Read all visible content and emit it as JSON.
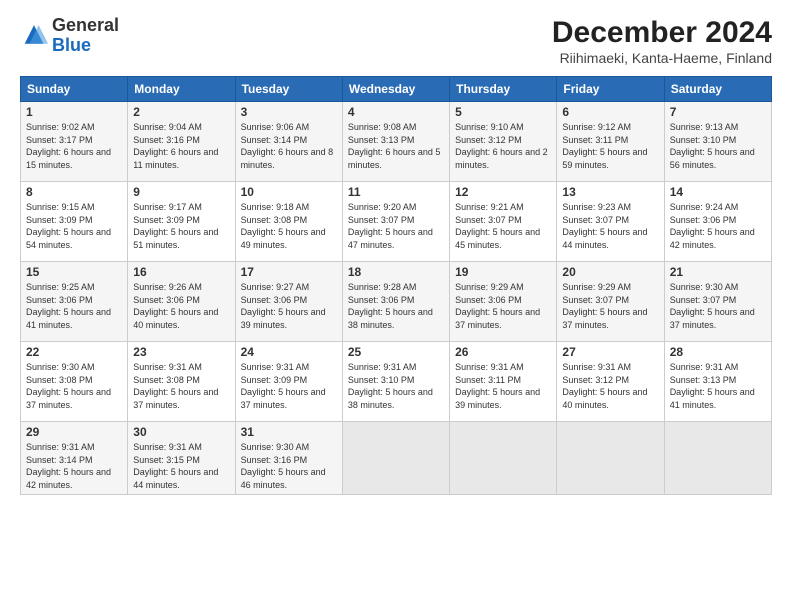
{
  "logo": {
    "general": "General",
    "blue": "Blue"
  },
  "title": "December 2024",
  "subtitle": "Riihimaeki, Kanta-Haeme, Finland",
  "days": [
    "Sunday",
    "Monday",
    "Tuesday",
    "Wednesday",
    "Thursday",
    "Friday",
    "Saturday"
  ],
  "weeks": [
    [
      {
        "num": "1",
        "sunrise": "9:02 AM",
        "sunset": "3:17 PM",
        "daylight": "6 hours and 15 minutes."
      },
      {
        "num": "2",
        "sunrise": "9:04 AM",
        "sunset": "3:16 PM",
        "daylight": "6 hours and 11 minutes."
      },
      {
        "num": "3",
        "sunrise": "9:06 AM",
        "sunset": "3:14 PM",
        "daylight": "6 hours and 8 minutes."
      },
      {
        "num": "4",
        "sunrise": "9:08 AM",
        "sunset": "3:13 PM",
        "daylight": "6 hours and 5 minutes."
      },
      {
        "num": "5",
        "sunrise": "9:10 AM",
        "sunset": "3:12 PM",
        "daylight": "6 hours and 2 minutes."
      },
      {
        "num": "6",
        "sunrise": "9:12 AM",
        "sunset": "3:11 PM",
        "daylight": "5 hours and 59 minutes."
      },
      {
        "num": "7",
        "sunrise": "9:13 AM",
        "sunset": "3:10 PM",
        "daylight": "5 hours and 56 minutes."
      }
    ],
    [
      {
        "num": "8",
        "sunrise": "9:15 AM",
        "sunset": "3:09 PM",
        "daylight": "5 hours and 54 minutes."
      },
      {
        "num": "9",
        "sunrise": "9:17 AM",
        "sunset": "3:09 PM",
        "daylight": "5 hours and 51 minutes."
      },
      {
        "num": "10",
        "sunrise": "9:18 AM",
        "sunset": "3:08 PM",
        "daylight": "5 hours and 49 minutes."
      },
      {
        "num": "11",
        "sunrise": "9:20 AM",
        "sunset": "3:07 PM",
        "daylight": "5 hours and 47 minutes."
      },
      {
        "num": "12",
        "sunrise": "9:21 AM",
        "sunset": "3:07 PM",
        "daylight": "5 hours and 45 minutes."
      },
      {
        "num": "13",
        "sunrise": "9:23 AM",
        "sunset": "3:07 PM",
        "daylight": "5 hours and 44 minutes."
      },
      {
        "num": "14",
        "sunrise": "9:24 AM",
        "sunset": "3:06 PM",
        "daylight": "5 hours and 42 minutes."
      }
    ],
    [
      {
        "num": "15",
        "sunrise": "9:25 AM",
        "sunset": "3:06 PM",
        "daylight": "5 hours and 41 minutes."
      },
      {
        "num": "16",
        "sunrise": "9:26 AM",
        "sunset": "3:06 PM",
        "daylight": "5 hours and 40 minutes."
      },
      {
        "num": "17",
        "sunrise": "9:27 AM",
        "sunset": "3:06 PM",
        "daylight": "5 hours and 39 minutes."
      },
      {
        "num": "18",
        "sunrise": "9:28 AM",
        "sunset": "3:06 PM",
        "daylight": "5 hours and 38 minutes."
      },
      {
        "num": "19",
        "sunrise": "9:29 AM",
        "sunset": "3:06 PM",
        "daylight": "5 hours and 37 minutes."
      },
      {
        "num": "20",
        "sunrise": "9:29 AM",
        "sunset": "3:07 PM",
        "daylight": "5 hours and 37 minutes."
      },
      {
        "num": "21",
        "sunrise": "9:30 AM",
        "sunset": "3:07 PM",
        "daylight": "5 hours and 37 minutes."
      }
    ],
    [
      {
        "num": "22",
        "sunrise": "9:30 AM",
        "sunset": "3:08 PM",
        "daylight": "5 hours and 37 minutes."
      },
      {
        "num": "23",
        "sunrise": "9:31 AM",
        "sunset": "3:08 PM",
        "daylight": "5 hours and 37 minutes."
      },
      {
        "num": "24",
        "sunrise": "9:31 AM",
        "sunset": "3:09 PM",
        "daylight": "5 hours and 37 minutes."
      },
      {
        "num": "25",
        "sunrise": "9:31 AM",
        "sunset": "3:10 PM",
        "daylight": "5 hours and 38 minutes."
      },
      {
        "num": "26",
        "sunrise": "9:31 AM",
        "sunset": "3:11 PM",
        "daylight": "5 hours and 39 minutes."
      },
      {
        "num": "27",
        "sunrise": "9:31 AM",
        "sunset": "3:12 PM",
        "daylight": "5 hours and 40 minutes."
      },
      {
        "num": "28",
        "sunrise": "9:31 AM",
        "sunset": "3:13 PM",
        "daylight": "5 hours and 41 minutes."
      }
    ],
    [
      {
        "num": "29",
        "sunrise": "9:31 AM",
        "sunset": "3:14 PM",
        "daylight": "5 hours and 42 minutes."
      },
      {
        "num": "30",
        "sunrise": "9:31 AM",
        "sunset": "3:15 PM",
        "daylight": "5 hours and 44 minutes."
      },
      {
        "num": "31",
        "sunrise": "9:30 AM",
        "sunset": "3:16 PM",
        "daylight": "5 hours and 46 minutes."
      },
      null,
      null,
      null,
      null
    ]
  ],
  "labels": {
    "sunrise": "Sunrise:",
    "sunset": "Sunset:",
    "daylight": "Daylight:"
  }
}
